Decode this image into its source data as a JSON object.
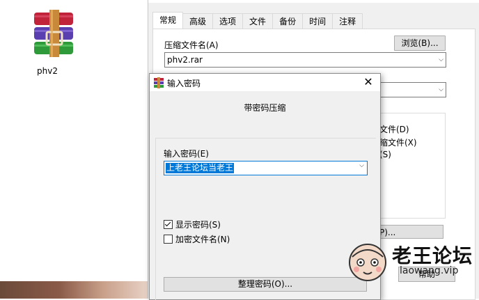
{
  "desktop": {
    "icon_label": "phv2"
  },
  "main_dialog": {
    "tabs": [
      "常规",
      "高级",
      "选项",
      "文件",
      "备份",
      "时间",
      "注释"
    ],
    "active_tab": "常规",
    "archive_name_label": "压缩文件名(A)",
    "archive_name_value": "phv2.rar",
    "browse_label": "浏览(B)...",
    "partial_options": [
      "文件(D)",
      "缩文件(X)",
      "(S)"
    ],
    "partial_button": "P)...",
    "help_label": "帮助"
  },
  "password_dialog": {
    "title": "输入密码",
    "heading": "带密码压缩",
    "enter_password_label": "输入密码(E)",
    "password_value": "上老王论坛当老王",
    "show_password_label": "显示密码(S)",
    "show_password_checked": true,
    "encrypt_filenames_label": "加密文件名(N)",
    "encrypt_filenames_checked": false,
    "organize_label": "整理密码(O)..."
  },
  "watermark": {
    "title": "老王论坛",
    "url": "laowang.vip"
  },
  "colors": {
    "selection": "#0078d7",
    "dialog_bg": "#f0f0f0",
    "button_bg": "#e1e1e1"
  }
}
